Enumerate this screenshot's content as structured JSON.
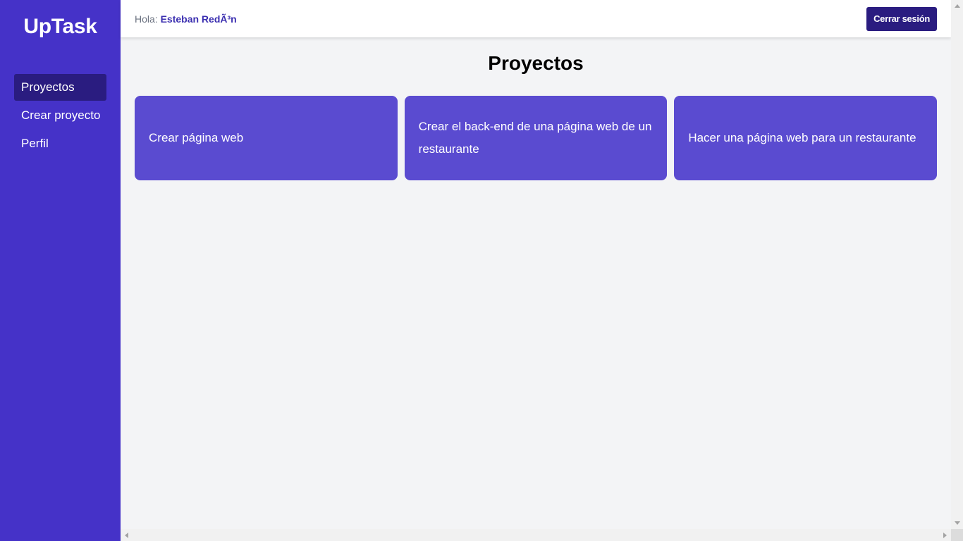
{
  "sidebar": {
    "logo": "UpTask",
    "items": [
      {
        "label": "Proyectos",
        "active": true
      },
      {
        "label": "Crear proyecto",
        "active": false
      },
      {
        "label": "Perfil",
        "active": false
      }
    ]
  },
  "topbar": {
    "greeting_prefix": "Hola:",
    "user_name": "Esteban RedÃ³n",
    "logout_label": "Cerrar sesión"
  },
  "main": {
    "title": "Proyectos",
    "projects": [
      {
        "name": "Crear página web"
      },
      {
        "name": "Crear el back-end de una página web de un restaurante"
      },
      {
        "name": "Hacer una página web para un restaurante"
      }
    ]
  },
  "colors": {
    "sidebar_bg": "#4532c8",
    "active_item_bg": "#2a1c80",
    "card_bg": "#5a4bd0",
    "button_bg": "#2a1c80",
    "user_name": "#3b2fb0",
    "page_bg": "#f3f4f6"
  }
}
